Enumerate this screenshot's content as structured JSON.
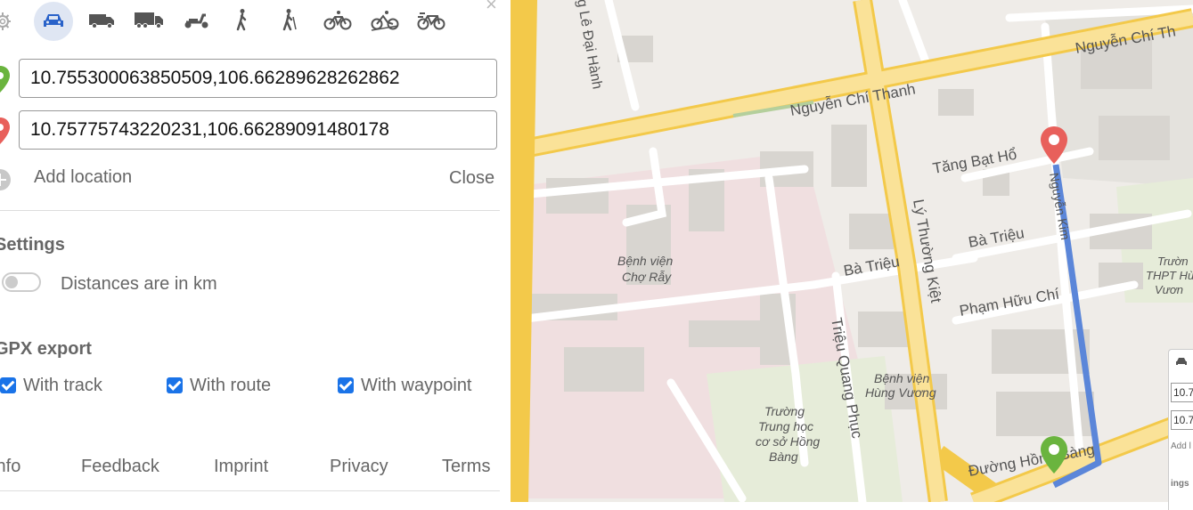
{
  "vehicles": [
    {
      "id": "car",
      "icon": "car-icon",
      "selected": true
    },
    {
      "id": "small-truck",
      "icon": "small-truck-icon",
      "selected": false
    },
    {
      "id": "truck",
      "icon": "truck-icon",
      "selected": false
    },
    {
      "id": "scooter",
      "icon": "scooter-icon",
      "selected": false
    },
    {
      "id": "foot",
      "icon": "walking-icon",
      "selected": false
    },
    {
      "id": "hike",
      "icon": "hiking-icon",
      "selected": false
    },
    {
      "id": "bike",
      "icon": "bicycle-icon",
      "selected": false
    },
    {
      "id": "mtb",
      "icon": "mountain-bike-icon",
      "selected": false
    },
    {
      "id": "racingbike",
      "icon": "racing-bike-icon",
      "selected": false
    }
  ],
  "locations": [
    {
      "value": "10.755300063850509,106.66289628262862",
      "marker_color": "#6ab43e"
    },
    {
      "value": "10.75775743220231,106.66289091480178",
      "marker_color": "#e8605b"
    }
  ],
  "add_location_label": "Add location",
  "close_label": "Close",
  "settings": {
    "title": "Settings",
    "distance_label": "Distances are in km",
    "distance_on": false
  },
  "gpx": {
    "title": "GPX export",
    "options": [
      {
        "label": "With track",
        "checked": true
      },
      {
        "label": "With route",
        "checked": true
      },
      {
        "label": "With waypoint",
        "checked": true
      }
    ]
  },
  "footer": {
    "links": [
      "Info",
      "Feedback",
      "Imprint",
      "Privacy",
      "Terms"
    ]
  },
  "map": {
    "labels": {
      "nguyen_chi_thanh": "Nguyễn Chí Thanh",
      "nguyen_chi_thanh_right": "Nguyễn Chí Th",
      "le_dai_hanh": "g Lê Đại Hành",
      "tang_bat_ho": "Tăng Bạt Hổ",
      "ba_trieu_1": "Bà Triệu",
      "ba_trieu_2": "Bà Triệu",
      "ly_thuong_kiet": "Lý Thường Kiệt",
      "pham_huu_chi": "Phạm Hữu Chí",
      "trieu_quang_phuc": "Triệu Quang Phục",
      "duong_hong_bang": "Đường Hồng Bàng",
      "nguyen_kim": "Nguyễn Kim",
      "benh_vien_cho_ray": [
        "Bệnh viện",
        "Chợ Rẫy"
      ],
      "benh_vien_hung_vuong": [
        "Bệnh viện",
        "Hùng Vương"
      ],
      "truong_thcs": [
        "Trường",
        "Trung học",
        "cơ sở Hồng",
        "Bàng"
      ],
      "truong_thpt": [
        "Trườn",
        "THPT Hù",
        "Vươn"
      ]
    },
    "route_color": "#5b86d9",
    "mini_panel": {
      "input1": "10.7",
      "input2": "10.7",
      "add_text": "Add l",
      "settings_text": "ings"
    }
  }
}
